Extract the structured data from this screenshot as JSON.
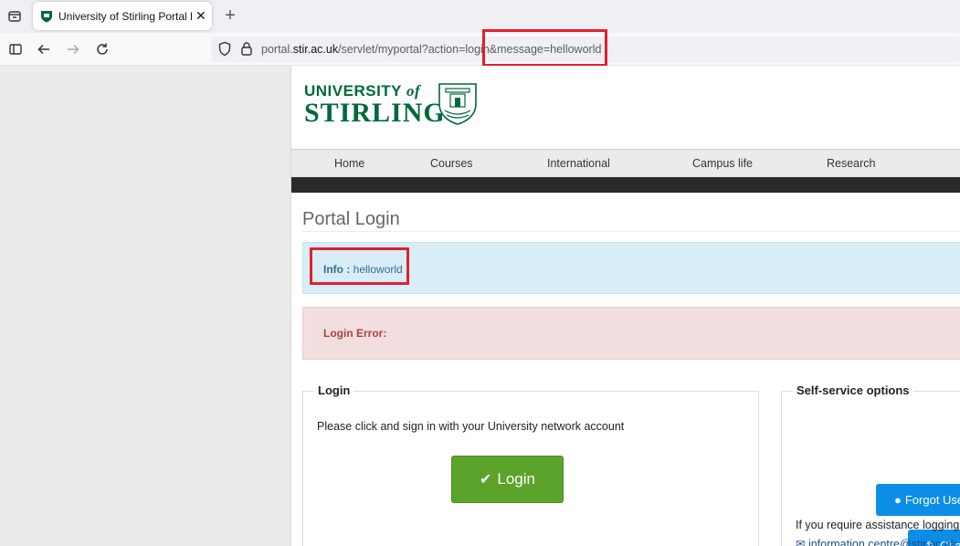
{
  "browser": {
    "tab_title": "University of Stirling Portal Logi",
    "tab_close": "✕",
    "new_tab": "+",
    "url_prefix": "portal.",
    "url_domain": "stir.ac.uk",
    "url_path": "/servlet/myportal?action=login&message=helloworld"
  },
  "logo": {
    "line1_a": "UNIVERSITY ",
    "line1_b": "of",
    "line2": "STIRLING"
  },
  "menu": {
    "items": [
      "Home",
      "Courses",
      "International",
      "Campus life",
      "Research"
    ]
  },
  "page": {
    "title": "Portal Login",
    "info_label": "Info :",
    "info_message": "helloworld",
    "error_label": "Login Error:"
  },
  "login_panel": {
    "legend": "Login",
    "instruction": "Please click and sign in with your University network account",
    "button_label": "Login"
  },
  "self_service": {
    "legend": "Self-service options",
    "forgot_button": "Forgot Use",
    "change_button": "Cha",
    "assist_text": "If you require assistance logging",
    "email": "information.centre@stir.ac.uk"
  },
  "colors": {
    "brand_green": "#006938",
    "highlight_red": "#e0202f",
    "login_green": "#5ba32a",
    "button_blue": "#0c8ee6"
  }
}
